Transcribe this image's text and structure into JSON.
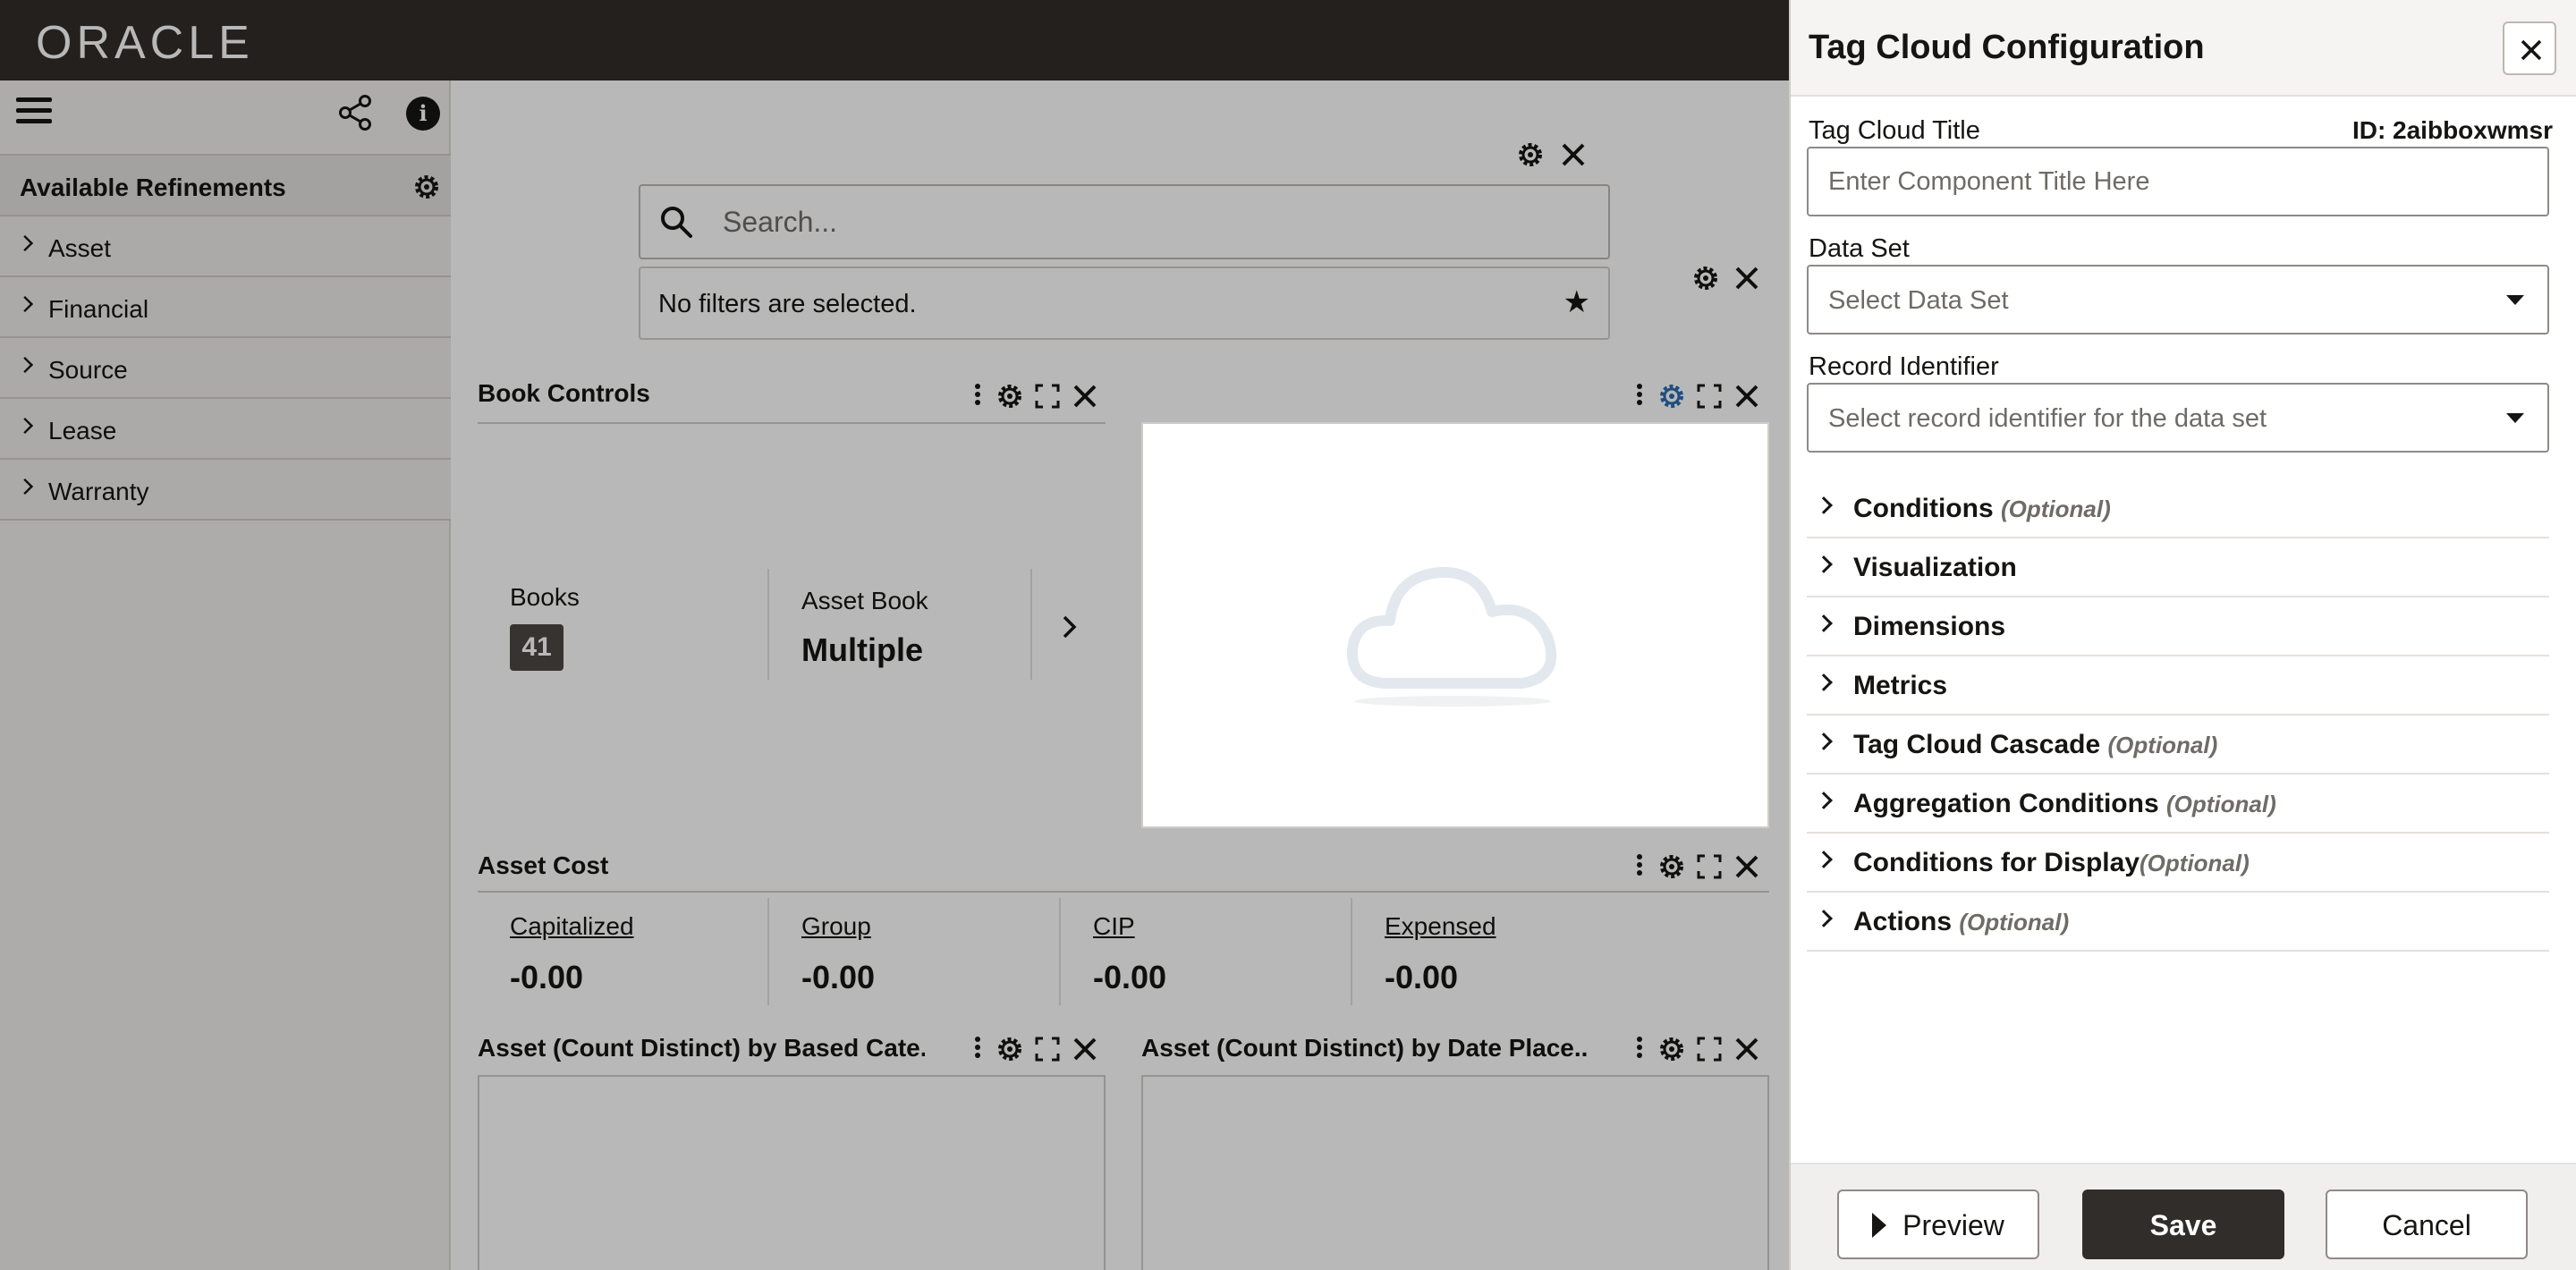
{
  "header": {
    "logo_text": "ORACLE"
  },
  "left_panel": {
    "refinements_title": "Available Refinements",
    "items": [
      {
        "label": "Asset"
      },
      {
        "label": "Financial"
      },
      {
        "label": "Source"
      },
      {
        "label": "Lease"
      },
      {
        "label": "Warranty"
      }
    ]
  },
  "search": {
    "placeholder": "Search...",
    "filters_text": "No filters are selected."
  },
  "book_controls": {
    "title": "Book Controls",
    "books_label": "Books",
    "books_count": "41",
    "asset_book_label": "Asset Book",
    "asset_book_value": "Multiple"
  },
  "asset_cost": {
    "title": "Asset Cost",
    "metrics": [
      {
        "label": "Capitalized",
        "value": "-0.00"
      },
      {
        "label": "Group",
        "value": "-0.00"
      },
      {
        "label": "CIP",
        "value": "-0.00"
      },
      {
        "label": "Expensed",
        "value": "-0.00"
      }
    ]
  },
  "charts": {
    "left_title": "Asset (Count Distinct) by Based Cate...",
    "right_title": "Asset (Count Distinct) by Date Place..."
  },
  "drawer": {
    "title": "Tag Cloud Configuration",
    "title_field_label": "Tag Cloud Title",
    "id_text": "ID: 2aibboxwmsr",
    "title_placeholder": "Enter Component Title Here",
    "dataset_label": "Data Set",
    "dataset_placeholder": "Select Data Set",
    "record_label": "Record Identifier",
    "record_placeholder": "Select record identifier for the data set",
    "sections": [
      {
        "name": "Conditions",
        "optional": "(Optional)"
      },
      {
        "name": "Visualization",
        "optional": ""
      },
      {
        "name": "Dimensions",
        "optional": ""
      },
      {
        "name": "Metrics",
        "optional": ""
      },
      {
        "name": "Tag Cloud Cascade",
        "optional": "(Optional)"
      },
      {
        "name": "Aggregation Conditions",
        "optional": "(Optional)"
      },
      {
        "name": "Conditions for Display",
        "optional": "(Optional)"
      },
      {
        "name": "Actions",
        "optional": "(Optional)"
      }
    ],
    "buttons": {
      "preview": "Preview",
      "save": "Save",
      "cancel": "Cancel"
    }
  },
  "colors": {
    "topbar": "#312d2a",
    "save_button": "#312d2a",
    "accent_gear": "#2b6cb0"
  }
}
